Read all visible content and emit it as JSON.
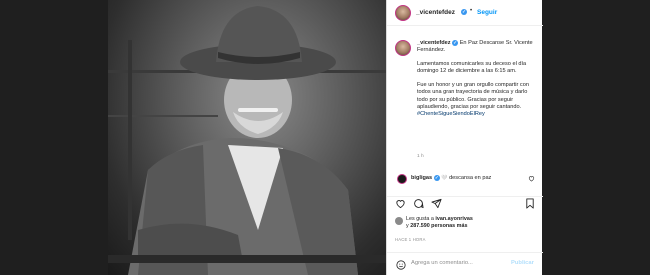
{
  "header": {
    "username": "_vicentefdez",
    "separator": "•",
    "follow_label": "Seguir",
    "verified_mark": "✓"
  },
  "caption": {
    "username": "_vicentefdez",
    "line1": "En Paz Descanse Sr. Vicente Fernández.",
    "paragraph2": "Lamentamos comunicarles su deceso el día domingo 12 de diciembre a las 6:15 am.",
    "paragraph3": "Fue un honor y un gran orgullo compartir con todos una gran trayectoria de música y darlo todo por su público. Gracias por seguir aplaudiendo, gracias por seguir cantando.",
    "hashtag": "#ChenteSigueSiendoElRey",
    "time_ago": "1 h"
  },
  "comment": {
    "username": "bigligas",
    "text": "descansa en paz"
  },
  "icons": {
    "like": "heart-icon",
    "comment": "comment-icon",
    "share": "share-icon",
    "save": "bookmark-icon",
    "emoji": "smiley-icon"
  },
  "likes": {
    "prefix": "Les gusta a",
    "user": "ivan.ayonrivas",
    "conjunction": "y",
    "count": "287.590 personas más"
  },
  "post_date": "HACE 1 HORA",
  "add_comment": {
    "placeholder": "Agrega un comentario...",
    "publish_label": "Publicar"
  },
  "colors": {
    "accent": "#0095f6",
    "verified": "#3897f0",
    "hashtag": "#00376b",
    "muted": "#8e8e8e"
  }
}
